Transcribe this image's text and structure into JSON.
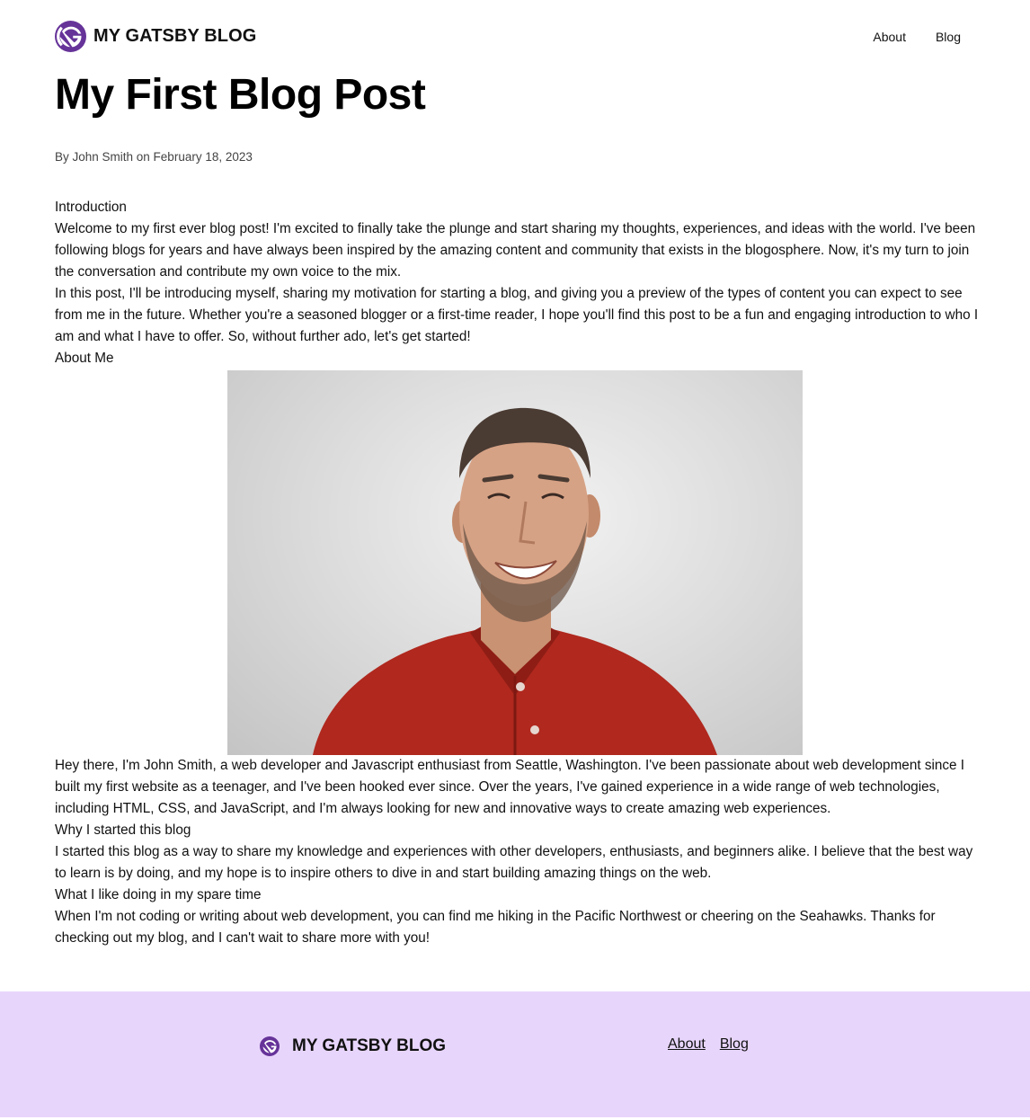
{
  "header": {
    "brand": "MY GATSBY BLOG",
    "nav": [
      {
        "label": "About"
      },
      {
        "label": "Blog"
      }
    ]
  },
  "post": {
    "title": "My First Blog Post",
    "byline": "By John Smith on February 18, 2023",
    "intro_heading": "Introduction",
    "intro_p1": "Welcome to my first ever blog post! I'm excited to finally take the plunge and start sharing my thoughts, experiences, and ideas with the world. I've been following blogs for years and have always been inspired by the amazing content and community that exists in the blogosphere. Now, it's my turn to join the conversation and contribute my own voice to the mix.",
    "intro_p2": "In this post, I'll be introducing myself, sharing my motivation for starting a blog, and giving you a preview of the types of content you can expect to see from me in the future. Whether you're a seasoned blogger or a first-time reader, I hope you'll find this post to be a fun and engaging introduction to who I am and what I have to offer. So, without further ado, let's get started!",
    "about_heading": "About Me",
    "about_p": "Hey there, I'm John Smith, a web developer and Javascript enthusiast from Seattle, Washington. I've been passionate about web development since I built my first website as a teenager, and I've been hooked ever since. Over the years, I've gained experience in a wide range of web technologies, including HTML, CSS, and JavaScript, and I'm always looking for new and innovative ways to create amazing web experiences.",
    "why_heading": "Why I started this blog",
    "why_p": "I started this blog as a way to share my knowledge and experiences with other developers, enthusiasts, and beginners alike. I believe that the best way to learn is by doing, and my hope is to inspire others to dive in and start building amazing things on the web.",
    "spare_heading": "What I like doing in my spare time",
    "spare_p": "When I'm not coding or writing about web development, you can find me hiking in the Pacific Northwest or cheering on the Seahawks. Thanks for checking out my blog, and I can't wait to share more with you!"
  },
  "footer": {
    "brand": "MY GATSBY BLOG",
    "nav": [
      {
        "label": "About"
      },
      {
        "label": "Blog"
      }
    ]
  },
  "colors": {
    "brand_purple": "#663399",
    "footer_bg": "#e8d5fb",
    "shirt_red": "#b0281e"
  },
  "icons": {
    "logo": "gatsby-logo-icon"
  }
}
